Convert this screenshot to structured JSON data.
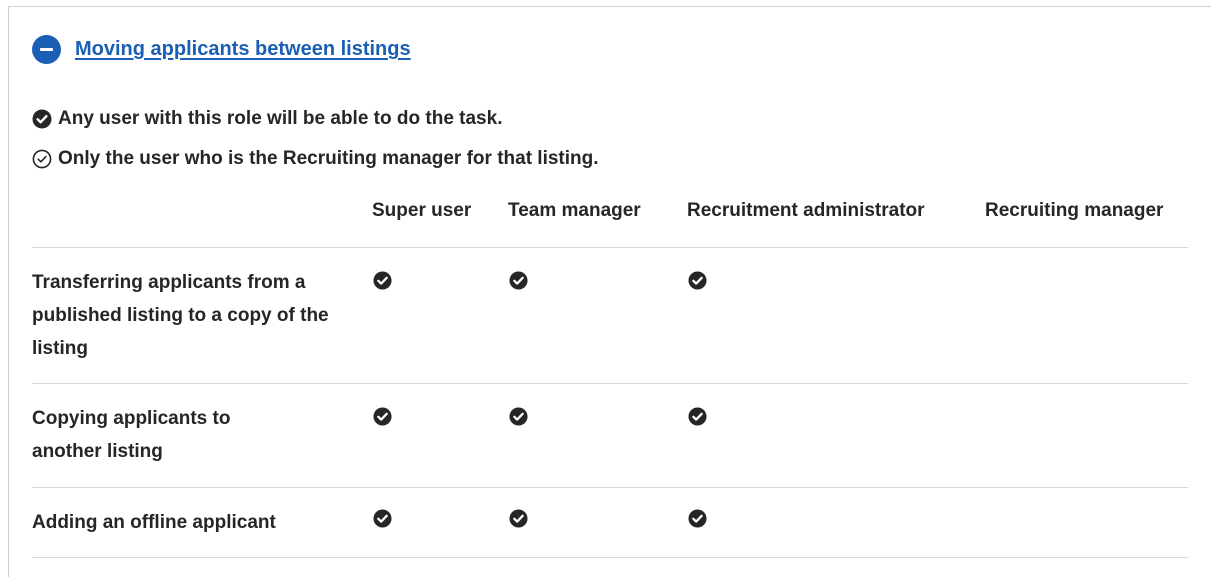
{
  "section": {
    "title": "Moving applicants between listings",
    "expand_state_icon": "minus-circle-icon",
    "accent_color": "#1a5fb4"
  },
  "legend": {
    "full_access": {
      "icon": "filled-check-circle-icon",
      "text": "Any user with this role will be able to do the task."
    },
    "limited_access": {
      "icon": "outline-check-circle-icon",
      "text": "Only the user who is the Recruiting manager for that listing."
    }
  },
  "table": {
    "columns": [
      "",
      "Super user",
      "Team manager",
      "Recruitment administrator",
      "Recruiting manager"
    ],
    "rows": [
      {
        "task": "Transferring applicants from a published listing to a copy of the listing",
        "super_user": "full",
        "team_manager": "full",
        "recruitment_administrator": "full",
        "recruiting_manager": "none"
      },
      {
        "task": "Copying applicants to another listing",
        "super_user": "full",
        "team_manager": "full",
        "recruitment_administrator": "full",
        "recruiting_manager": "none"
      },
      {
        "task": "Adding an offline applicant",
        "super_user": "full",
        "team_manager": "full",
        "recruitment_administrator": "full",
        "recruiting_manager": "none"
      }
    ]
  }
}
